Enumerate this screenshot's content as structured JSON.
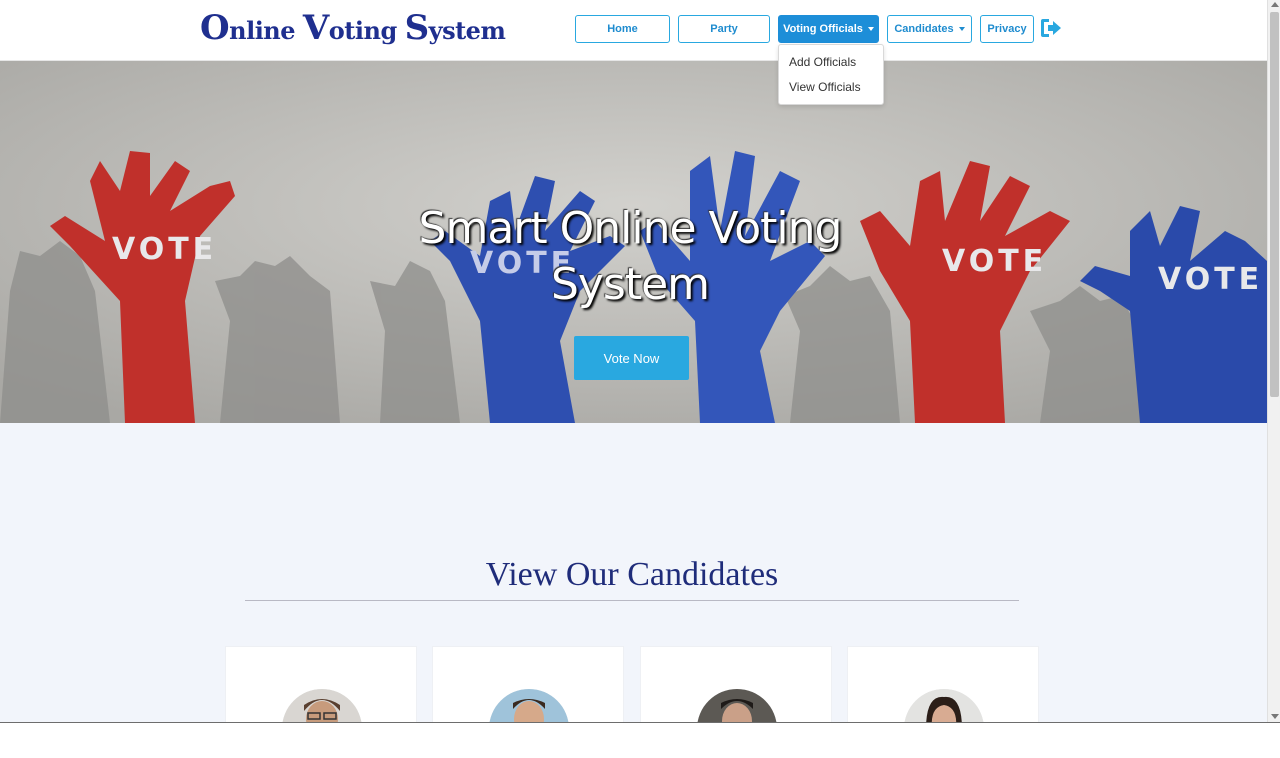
{
  "brand": {
    "v1": "O",
    "t1": "nline ",
    "v2": "V",
    "t2": "oting ",
    "v3": "S",
    "t3": "ystem"
  },
  "nav": {
    "home": "Home",
    "party": "Party",
    "voting_officials": "Voting Officials",
    "candidates": "Candidates",
    "privacy": "Privacy"
  },
  "dropdown": {
    "add": "Add Officials",
    "view": "View Officials"
  },
  "hero": {
    "title_line1": "Smart Online Voting",
    "title_line2": "System",
    "vote_button": "Vote Now",
    "sign_text": "VOTE"
  },
  "candidates_section": {
    "title": "View Our Candidates"
  },
  "colors": {
    "accent": "#29a8e0",
    "brand": "#1f2f8f",
    "sign_red": "#c0302b",
    "sign_blue": "#2e4fb0"
  },
  "icons": {
    "logout": "sign-out-icon"
  }
}
